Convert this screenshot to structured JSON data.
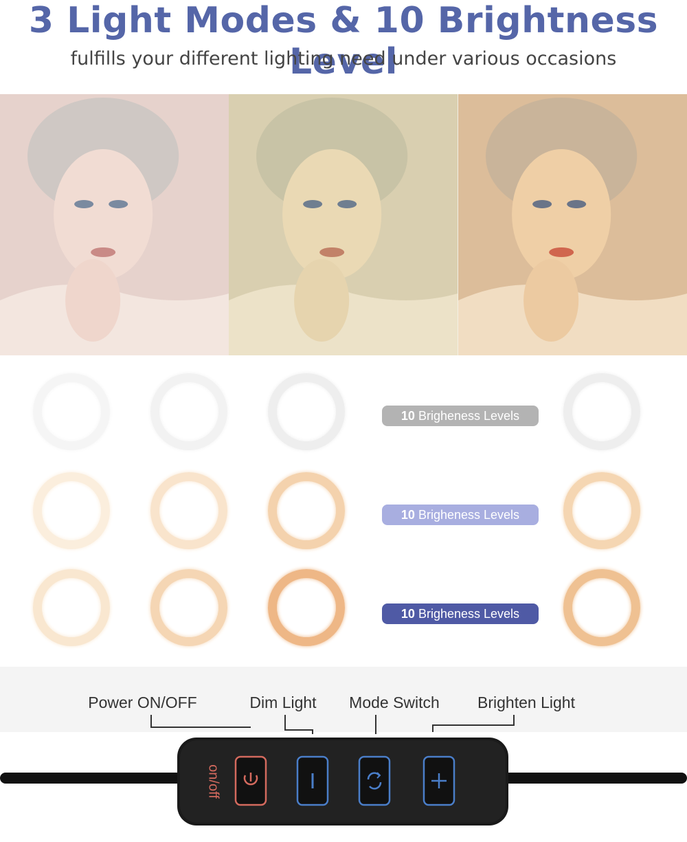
{
  "header": {
    "title": "3 Light Modes & 10 Brightness Level",
    "subtitle": "fulfills your different lighting need under various occasions"
  },
  "photos": [
    {
      "mode": "white-light",
      "tint": "#e9cfca"
    },
    {
      "mode": "warm-white-light",
      "tint": "#d8c79a"
    },
    {
      "mode": "warm-yellow-light",
      "tint": "#ddb184"
    }
  ],
  "rings": {
    "rows": [
      {
        "mode": "white",
        "colors": [
          "#f5f5f5",
          "#f2f2f2",
          "#eeeeee",
          "#eeeeee"
        ]
      },
      {
        "mode": "warm-white",
        "colors": [
          "#fbeedd",
          "#f9e4cc",
          "#f4d2ad",
          "#f5d6b2"
        ]
      },
      {
        "mode": "warm-yellow",
        "colors": [
          "#f9e7d0",
          "#f5d6b4",
          "#eeb786",
          "#efc192"
        ]
      }
    ]
  },
  "brightness_pills": [
    {
      "number": "10",
      "text": "Brigheness Levels",
      "color": "#b3b3b3"
    },
    {
      "number": "10",
      "text": "Brigheness Levels",
      "color": "#a8aee0"
    },
    {
      "number": "10",
      "text": "Brigheness Levels",
      "color": "#4f5aa5"
    }
  ],
  "controls": {
    "power_label": "Power ON/OFF",
    "dim_label": "Dim Light",
    "mode_label": "Mode Switch",
    "brighten_label": "Brighten Light",
    "onoff_text": "on/off"
  },
  "colors": {
    "title": "#5566a8",
    "button_outline_blue": "#4a7ec9",
    "button_outline_red": "#d46a5e"
  }
}
